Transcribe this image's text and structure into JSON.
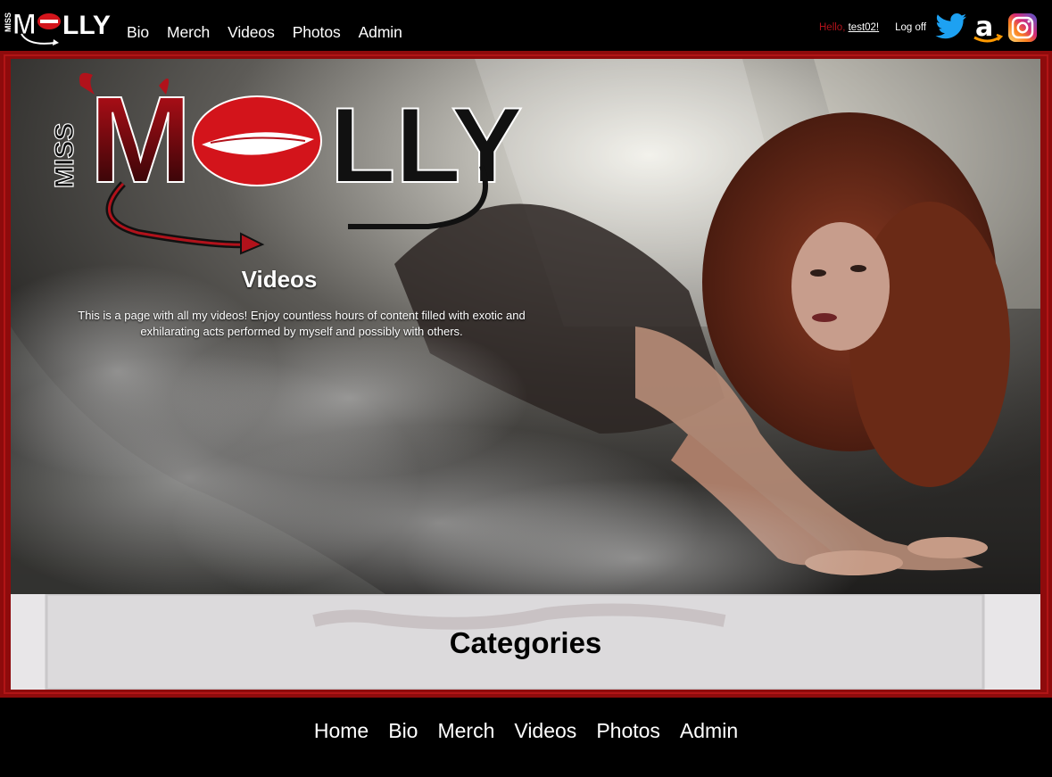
{
  "brand": {
    "logo_text_miss": "Miss",
    "logo_text_molly": "MOLLY"
  },
  "nav": {
    "items": [
      "Bio",
      "Merch",
      "Videos",
      "Photos",
      "Admin"
    ]
  },
  "user": {
    "hello": "Hello,",
    "username": "test02!",
    "logoff": "Log off"
  },
  "social": [
    "twitter-icon",
    "amazon-icon",
    "instagram-icon"
  ],
  "hero": {
    "logo_miss": "MISS",
    "logo_molly": "MOLLY",
    "title": "Videos",
    "description": "This is a page with all my videos! Enjoy countless hours of content filled with exotic and exhilarating acts performed by myself and possibly with others."
  },
  "categories": {
    "title": "Categories"
  },
  "footer": {
    "items": [
      "Home",
      "Bio",
      "Merch",
      "Videos",
      "Photos",
      "Admin"
    ]
  },
  "colors": {
    "frame": "#8e0b0c",
    "accent_red": "#b1121b",
    "twitter": "#1da1f2",
    "amazon": "#ff9900"
  }
}
